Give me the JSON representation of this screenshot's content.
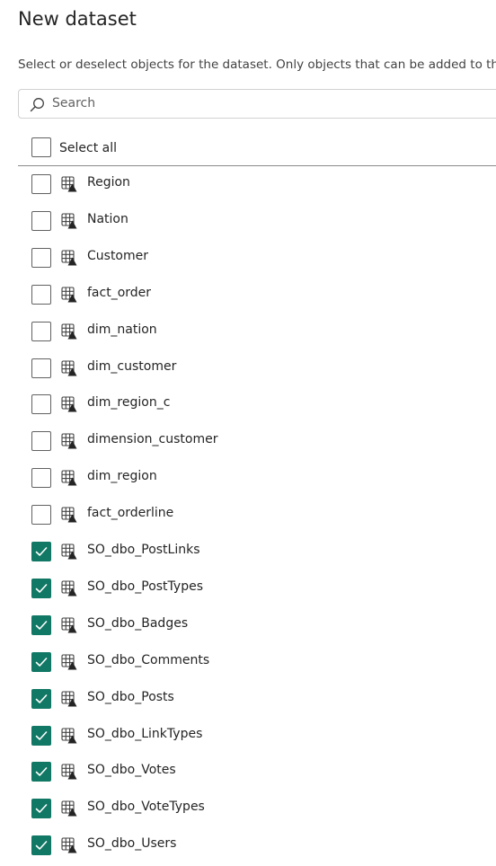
{
  "header": {
    "title": "New dataset",
    "description": "Select or deselect objects for the dataset. Only objects that can be added to th"
  },
  "search": {
    "placeholder": "Search"
  },
  "select_all": {
    "label": "Select all",
    "checked": false
  },
  "accent_color": "#117865",
  "table_icon": "table-with-warning-icon",
  "items": [
    {
      "label": "Region",
      "checked": false
    },
    {
      "label": "Nation",
      "checked": false
    },
    {
      "label": "Customer",
      "checked": false
    },
    {
      "label": "fact_order",
      "checked": false
    },
    {
      "label": "dim_nation",
      "checked": false
    },
    {
      "label": "dim_customer",
      "checked": false
    },
    {
      "label": "dim_region_c",
      "checked": false
    },
    {
      "label": "dimension_customer",
      "checked": false
    },
    {
      "label": "dim_region",
      "checked": false
    },
    {
      "label": "fact_orderline",
      "checked": false
    },
    {
      "label": "SO_dbo_PostLinks",
      "checked": true
    },
    {
      "label": "SO_dbo_PostTypes",
      "checked": true
    },
    {
      "label": "SO_dbo_Badges",
      "checked": true
    },
    {
      "label": "SO_dbo_Comments",
      "checked": true
    },
    {
      "label": "SO_dbo_Posts",
      "checked": true
    },
    {
      "label": "SO_dbo_LinkTypes",
      "checked": true
    },
    {
      "label": "SO_dbo_Votes",
      "checked": true
    },
    {
      "label": "SO_dbo_VoteTypes",
      "checked": true
    },
    {
      "label": "SO_dbo_Users",
      "checked": true
    }
  ]
}
